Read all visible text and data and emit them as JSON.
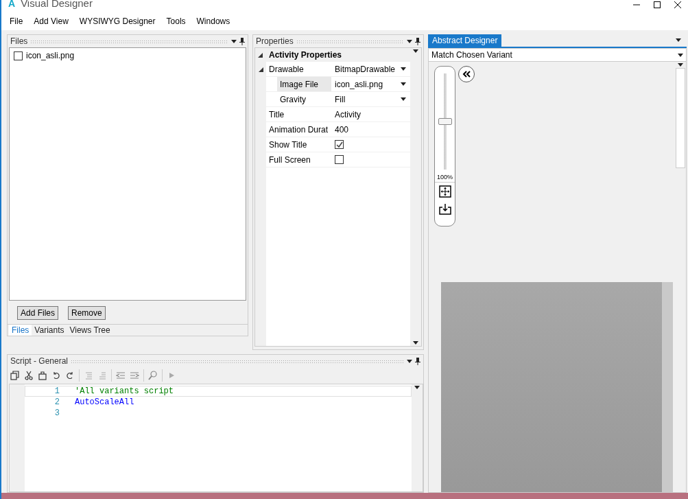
{
  "window": {
    "title": "Visual Designer",
    "logo": "A"
  },
  "menu": [
    "File",
    "Add View",
    "WYSIWYG Designer",
    "Tools",
    "Windows"
  ],
  "files_panel": {
    "title": "Files",
    "items": [
      {
        "name": "icon_asli.png",
        "checked": false
      }
    ],
    "buttons": [
      "Add Files",
      "Remove"
    ],
    "tabs": [
      {
        "label": "Files",
        "selected": true
      },
      {
        "label": "Variants",
        "selected": false
      },
      {
        "label": "Views Tree",
        "selected": false
      }
    ]
  },
  "properties_panel": {
    "title": "Properties",
    "category": {
      "label": "Activity Properties",
      "expanded": true
    },
    "rows": [
      {
        "name": "Drawable",
        "kind": "dropdown",
        "value": "BitmapDrawable",
        "expanded": true,
        "selected": false,
        "children": [
          {
            "name": "Image File",
            "kind": "dropdown",
            "value": "icon_asli.png",
            "selected": true
          },
          {
            "name": "Gravity",
            "kind": "dropdown",
            "value": "Fill",
            "selected": false
          }
        ]
      },
      {
        "name": "Title",
        "kind": "text",
        "value": "Activity",
        "selected": false
      },
      {
        "name": "Animation Durat",
        "kind": "text",
        "value": "400",
        "selected": false
      },
      {
        "name": "Show Title",
        "kind": "checkbox",
        "checked": true,
        "selected": false
      },
      {
        "name": "Full Screen",
        "kind": "checkbox",
        "checked": false,
        "selected": false
      }
    ]
  },
  "script_panel": {
    "title": "Script - General",
    "lines": [
      {
        "number": "1",
        "kind": "comment",
        "text": "'All variants script",
        "current": true
      },
      {
        "number": "2",
        "kind": "keyword",
        "text": "AutoScaleAll",
        "current": false
      },
      {
        "number": "3",
        "current": false
      }
    ]
  },
  "designer_panel": {
    "tab": "Abstract Designer",
    "variant": "Match Chosen Variant",
    "zoom": {
      "level": 0.5,
      "reading": "100%"
    }
  }
}
